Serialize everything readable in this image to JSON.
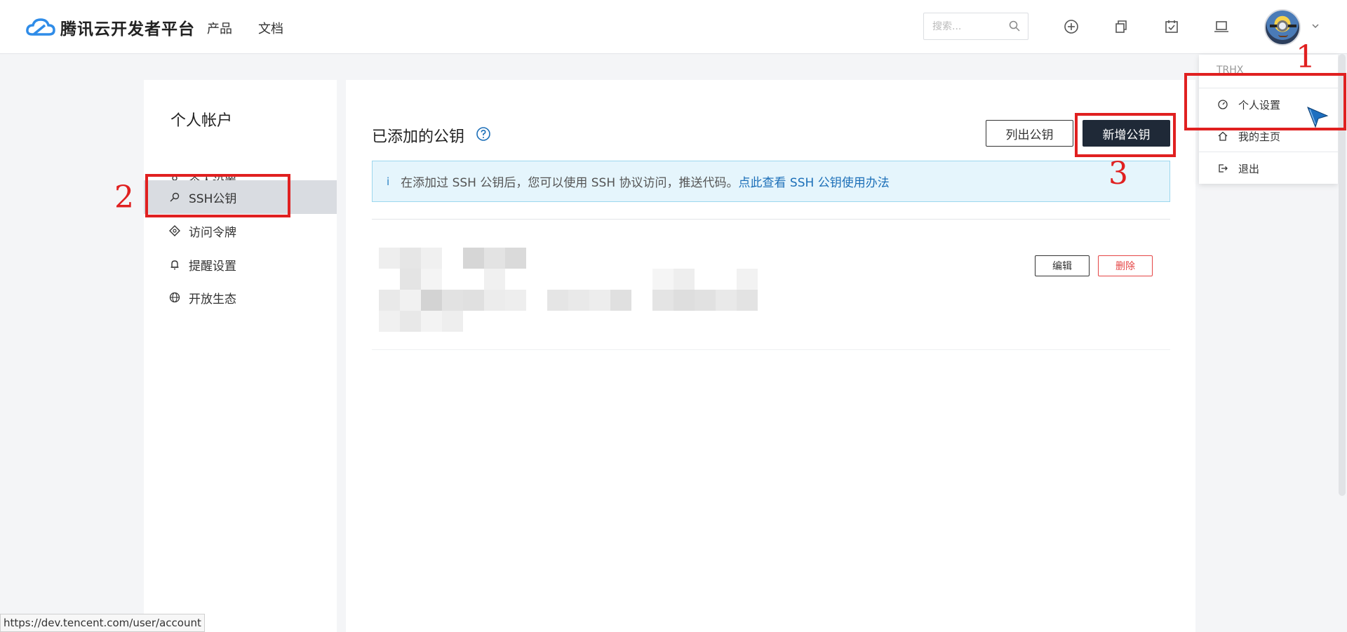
{
  "header": {
    "brand": "腾讯云开发者平台",
    "nav": [
      "产品",
      "文档"
    ],
    "search_placeholder": "搜索..."
  },
  "sidebar": {
    "title": "个人帐户",
    "items": [
      {
        "label": "个人设置",
        "icon": "user-icon"
      },
      {
        "label": "SSH公钥",
        "icon": "key-icon"
      },
      {
        "label": "访问令牌",
        "icon": "token-icon"
      },
      {
        "label": "提醒设置",
        "icon": "bell-icon"
      },
      {
        "label": "开放生态",
        "icon": "globe-icon"
      }
    ]
  },
  "main": {
    "title": "已添加的公钥",
    "list_button": "列出公钥",
    "add_button": "新增公钥",
    "info_text": "在添加过 SSH 公钥后，您可以使用 SSH 协议访问，推送代码。",
    "info_link": "点此查看 SSH 公钥使用办法",
    "info_icon": "i",
    "key_row": {
      "edit": "编辑",
      "delete": "删除"
    }
  },
  "dropdown": {
    "username": "TRHX",
    "items": [
      "个人设置",
      "我的主页",
      "退出"
    ]
  },
  "annotations": [
    "1",
    "2",
    "3"
  ],
  "statusbar": {
    "url": "https://dev.tencent.com/user/account"
  },
  "colors": {
    "accent_dark": "#1f2937",
    "annotation_red": "#e02020",
    "link_blue": "#1c6fb8",
    "danger": "#e54545"
  }
}
